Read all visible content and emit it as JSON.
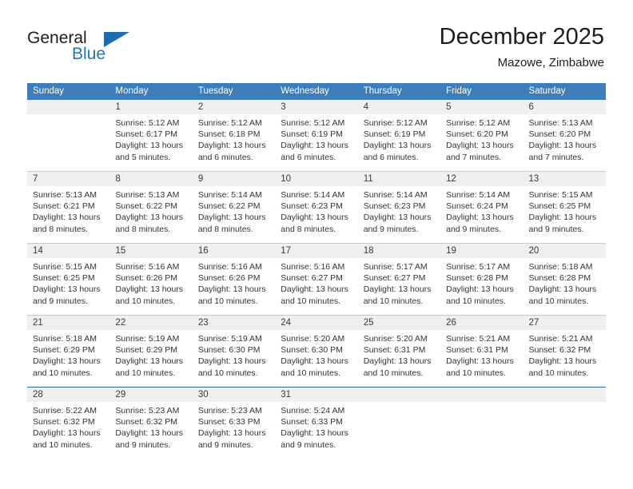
{
  "branding": {
    "name_part1": "General",
    "name_part2": "Blue",
    "flag_icon": "blue-triangle-flag-icon",
    "accent_color": "#1b75bb",
    "header_color": "#3c7dba"
  },
  "header": {
    "title": "December 2025",
    "location": "Mazowe, Zimbabwe"
  },
  "weekdays": [
    "Sunday",
    "Monday",
    "Tuesday",
    "Wednesday",
    "Thursday",
    "Friday",
    "Saturday"
  ],
  "weeks": [
    {
      "days": [
        {
          "num": "",
          "sunrise": "",
          "sunset": "",
          "daylight1": "",
          "daylight2": ""
        },
        {
          "num": "1",
          "sunrise": "Sunrise: 5:12 AM",
          "sunset": "Sunset: 6:17 PM",
          "daylight1": "Daylight: 13 hours",
          "daylight2": "and 5 minutes."
        },
        {
          "num": "2",
          "sunrise": "Sunrise: 5:12 AM",
          "sunset": "Sunset: 6:18 PM",
          "daylight1": "Daylight: 13 hours",
          "daylight2": "and 6 minutes."
        },
        {
          "num": "3",
          "sunrise": "Sunrise: 5:12 AM",
          "sunset": "Sunset: 6:19 PM",
          "daylight1": "Daylight: 13 hours",
          "daylight2": "and 6 minutes."
        },
        {
          "num": "4",
          "sunrise": "Sunrise: 5:12 AM",
          "sunset": "Sunset: 6:19 PM",
          "daylight1": "Daylight: 13 hours",
          "daylight2": "and 6 minutes."
        },
        {
          "num": "5",
          "sunrise": "Sunrise: 5:12 AM",
          "sunset": "Sunset: 6:20 PM",
          "daylight1": "Daylight: 13 hours",
          "daylight2": "and 7 minutes."
        },
        {
          "num": "6",
          "sunrise": "Sunrise: 5:13 AM",
          "sunset": "Sunset: 6:20 PM",
          "daylight1": "Daylight: 13 hours",
          "daylight2": "and 7 minutes."
        }
      ]
    },
    {
      "days": [
        {
          "num": "7",
          "sunrise": "Sunrise: 5:13 AM",
          "sunset": "Sunset: 6:21 PM",
          "daylight1": "Daylight: 13 hours",
          "daylight2": "and 8 minutes."
        },
        {
          "num": "8",
          "sunrise": "Sunrise: 5:13 AM",
          "sunset": "Sunset: 6:22 PM",
          "daylight1": "Daylight: 13 hours",
          "daylight2": "and 8 minutes."
        },
        {
          "num": "9",
          "sunrise": "Sunrise: 5:14 AM",
          "sunset": "Sunset: 6:22 PM",
          "daylight1": "Daylight: 13 hours",
          "daylight2": "and 8 minutes."
        },
        {
          "num": "10",
          "sunrise": "Sunrise: 5:14 AM",
          "sunset": "Sunset: 6:23 PM",
          "daylight1": "Daylight: 13 hours",
          "daylight2": "and 8 minutes."
        },
        {
          "num": "11",
          "sunrise": "Sunrise: 5:14 AM",
          "sunset": "Sunset: 6:23 PM",
          "daylight1": "Daylight: 13 hours",
          "daylight2": "and 9 minutes."
        },
        {
          "num": "12",
          "sunrise": "Sunrise: 5:14 AM",
          "sunset": "Sunset: 6:24 PM",
          "daylight1": "Daylight: 13 hours",
          "daylight2": "and 9 minutes."
        },
        {
          "num": "13",
          "sunrise": "Sunrise: 5:15 AM",
          "sunset": "Sunset: 6:25 PM",
          "daylight1": "Daylight: 13 hours",
          "daylight2": "and 9 minutes."
        }
      ]
    },
    {
      "days": [
        {
          "num": "14",
          "sunrise": "Sunrise: 5:15 AM",
          "sunset": "Sunset: 6:25 PM",
          "daylight1": "Daylight: 13 hours",
          "daylight2": "and 9 minutes."
        },
        {
          "num": "15",
          "sunrise": "Sunrise: 5:16 AM",
          "sunset": "Sunset: 6:26 PM",
          "daylight1": "Daylight: 13 hours",
          "daylight2": "and 10 minutes."
        },
        {
          "num": "16",
          "sunrise": "Sunrise: 5:16 AM",
          "sunset": "Sunset: 6:26 PM",
          "daylight1": "Daylight: 13 hours",
          "daylight2": "and 10 minutes."
        },
        {
          "num": "17",
          "sunrise": "Sunrise: 5:16 AM",
          "sunset": "Sunset: 6:27 PM",
          "daylight1": "Daylight: 13 hours",
          "daylight2": "and 10 minutes."
        },
        {
          "num": "18",
          "sunrise": "Sunrise: 5:17 AM",
          "sunset": "Sunset: 6:27 PM",
          "daylight1": "Daylight: 13 hours",
          "daylight2": "and 10 minutes."
        },
        {
          "num": "19",
          "sunrise": "Sunrise: 5:17 AM",
          "sunset": "Sunset: 6:28 PM",
          "daylight1": "Daylight: 13 hours",
          "daylight2": "and 10 minutes."
        },
        {
          "num": "20",
          "sunrise": "Sunrise: 5:18 AM",
          "sunset": "Sunset: 6:28 PM",
          "daylight1": "Daylight: 13 hours",
          "daylight2": "and 10 minutes."
        }
      ]
    },
    {
      "days": [
        {
          "num": "21",
          "sunrise": "Sunrise: 5:18 AM",
          "sunset": "Sunset: 6:29 PM",
          "daylight1": "Daylight: 13 hours",
          "daylight2": "and 10 minutes."
        },
        {
          "num": "22",
          "sunrise": "Sunrise: 5:19 AM",
          "sunset": "Sunset: 6:29 PM",
          "daylight1": "Daylight: 13 hours",
          "daylight2": "and 10 minutes."
        },
        {
          "num": "23",
          "sunrise": "Sunrise: 5:19 AM",
          "sunset": "Sunset: 6:30 PM",
          "daylight1": "Daylight: 13 hours",
          "daylight2": "and 10 minutes."
        },
        {
          "num": "24",
          "sunrise": "Sunrise: 5:20 AM",
          "sunset": "Sunset: 6:30 PM",
          "daylight1": "Daylight: 13 hours",
          "daylight2": "and 10 minutes."
        },
        {
          "num": "25",
          "sunrise": "Sunrise: 5:20 AM",
          "sunset": "Sunset: 6:31 PM",
          "daylight1": "Daylight: 13 hours",
          "daylight2": "and 10 minutes."
        },
        {
          "num": "26",
          "sunrise": "Sunrise: 5:21 AM",
          "sunset": "Sunset: 6:31 PM",
          "daylight1": "Daylight: 13 hours",
          "daylight2": "and 10 minutes."
        },
        {
          "num": "27",
          "sunrise": "Sunrise: 5:21 AM",
          "sunset": "Sunset: 6:32 PM",
          "daylight1": "Daylight: 13 hours",
          "daylight2": "and 10 minutes."
        }
      ]
    },
    {
      "days": [
        {
          "num": "28",
          "sunrise": "Sunrise: 5:22 AM",
          "sunset": "Sunset: 6:32 PM",
          "daylight1": "Daylight: 13 hours",
          "daylight2": "and 10 minutes."
        },
        {
          "num": "29",
          "sunrise": "Sunrise: 5:23 AM",
          "sunset": "Sunset: 6:32 PM",
          "daylight1": "Daylight: 13 hours",
          "daylight2": "and 9 minutes."
        },
        {
          "num": "30",
          "sunrise": "Sunrise: 5:23 AM",
          "sunset": "Sunset: 6:33 PM",
          "daylight1": "Daylight: 13 hours",
          "daylight2": "and 9 minutes."
        },
        {
          "num": "31",
          "sunrise": "Sunrise: 5:24 AM",
          "sunset": "Sunset: 6:33 PM",
          "daylight1": "Daylight: 13 hours",
          "daylight2": "and 9 minutes."
        },
        {
          "num": "",
          "sunrise": "",
          "sunset": "",
          "daylight1": "",
          "daylight2": ""
        },
        {
          "num": "",
          "sunrise": "",
          "sunset": "",
          "daylight1": "",
          "daylight2": ""
        },
        {
          "num": "",
          "sunrise": "",
          "sunset": "",
          "daylight1": "",
          "daylight2": ""
        }
      ]
    }
  ]
}
